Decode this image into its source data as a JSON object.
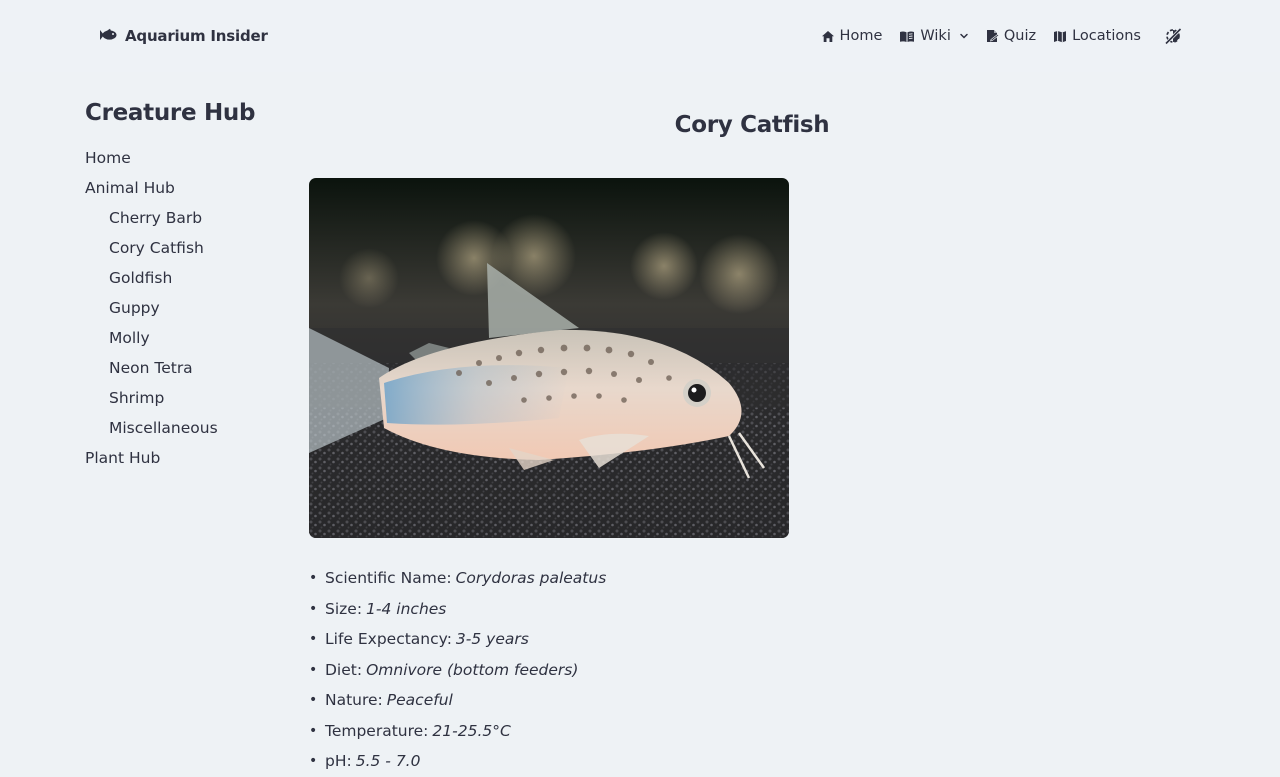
{
  "header": {
    "brand": "Aquarium Insider",
    "nav": [
      {
        "label": "Home",
        "icon": "home-icon"
      },
      {
        "label": "Wiki",
        "icon": "book-icon",
        "dropdown": true
      },
      {
        "label": "Quiz",
        "icon": "quiz-icon"
      },
      {
        "label": "Locations",
        "icon": "map-icon"
      }
    ],
    "theme_toggle_icon": "theme-toggle-icon"
  },
  "sidebar": {
    "title": "Creature Hub",
    "items": [
      {
        "label": "Home",
        "level": 0
      },
      {
        "label": "Animal Hub",
        "level": 0
      },
      {
        "label": "Cherry Barb",
        "level": 1
      },
      {
        "label": "Cory Catfish",
        "level": 1
      },
      {
        "label": "Goldfish",
        "level": 1
      },
      {
        "label": "Guppy",
        "level": 1
      },
      {
        "label": "Molly",
        "level": 1
      },
      {
        "label": "Neon Tetra",
        "level": 1
      },
      {
        "label": "Shrimp",
        "level": 1
      },
      {
        "label": "Miscellaneous",
        "level": 1
      },
      {
        "label": "Plant Hub",
        "level": 0
      }
    ]
  },
  "main": {
    "title": "Cory Catfish",
    "facts": [
      {
        "label": "Scientific Name:",
        "value": "Corydoras paleatus"
      },
      {
        "label": "Size:",
        "value": "1-4 inches"
      },
      {
        "label": "Life Expectancy:",
        "value": "3-5 years"
      },
      {
        "label": "Diet:",
        "value": "Omnivore (bottom feeders)"
      },
      {
        "label": "Nature:",
        "value": "Peaceful"
      },
      {
        "label": "Temperature:",
        "value": "21-25.5°C"
      },
      {
        "label": "pH:",
        "value": "5.5 - 7.0"
      }
    ]
  },
  "colors": {
    "background": "#eef2f5",
    "text": "#2f3241"
  }
}
